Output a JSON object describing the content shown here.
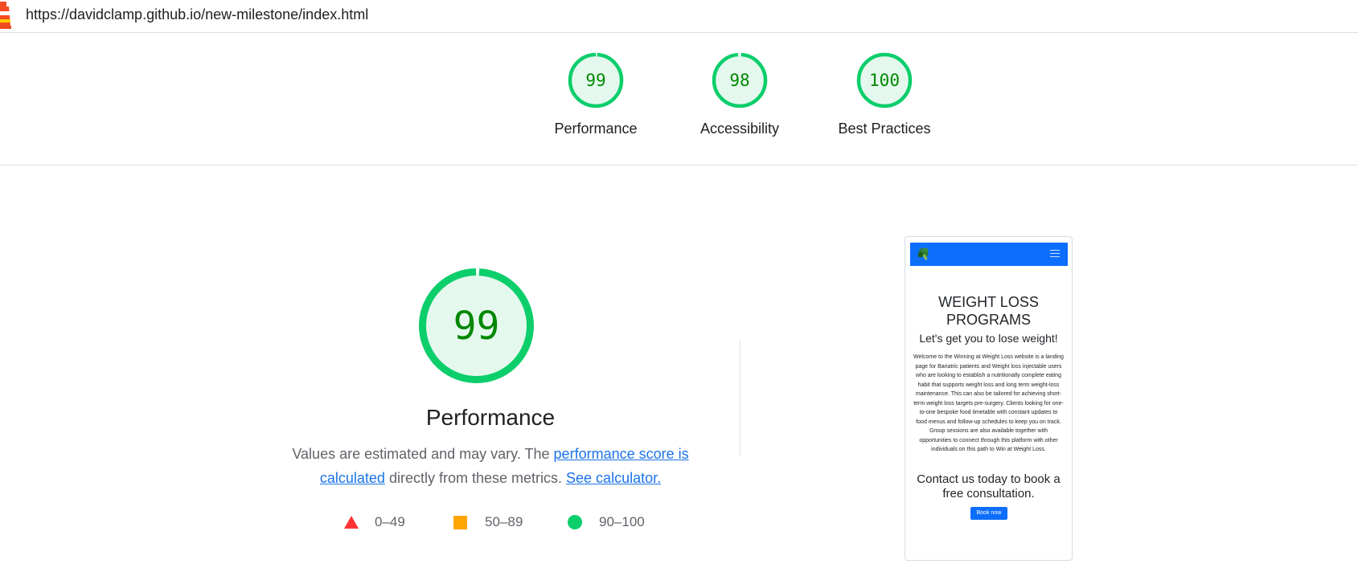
{
  "header": {
    "url": "https://davidclamp.github.io/new-milestone/index.html"
  },
  "gauges": [
    {
      "score": "99",
      "value": 99,
      "label": "Performance"
    },
    {
      "score": "98",
      "value": 98,
      "label": "Accessibility"
    },
    {
      "score": "100",
      "value": 100,
      "label": "Best Practices"
    }
  ],
  "colors": {
    "pass": "#0cce6b",
    "pass_bg": "#e5f8ee",
    "pass_text": "#008800",
    "average": "#ffa400",
    "fail": "#ff3333",
    "link": "#1a73e8"
  },
  "main": {
    "score": "99",
    "value": 99,
    "title": "Performance",
    "desc_prefix": "Values are estimated and may vary. The ",
    "desc_link": "performance score is calculated",
    "desc_middle": " directly from these metrics.",
    "calc_link": "See calculator."
  },
  "legend": {
    "fail": "0–49",
    "average": "50–89",
    "pass": "90–100"
  },
  "screenshot": {
    "heading": "WEIGHT LOSS PROGRAMS",
    "subheading": "Let's get you to lose weight!",
    "body": "Welcome to the Winning at Weight Loss website is a landing page for Bariatric patients and Weight loss injectable users who are looking to establish a nutritionally complete eating habit that supports weight loss and long term weight-loss maintenance. This can also be tailored for achieving short-term weight loss targets pre-surgery. Clients looking for one-to-one bespoke food timetable with constant updates to food menus and follow-up schedules to keep you on track. Group sessions are also available together with opportunities to connect through this platform with other individuals on this path to Win at Weight Loss.",
    "contact": "Contact us today to book a free consultation.",
    "button": "Book now",
    "nav_color": "#0d6efd"
  }
}
